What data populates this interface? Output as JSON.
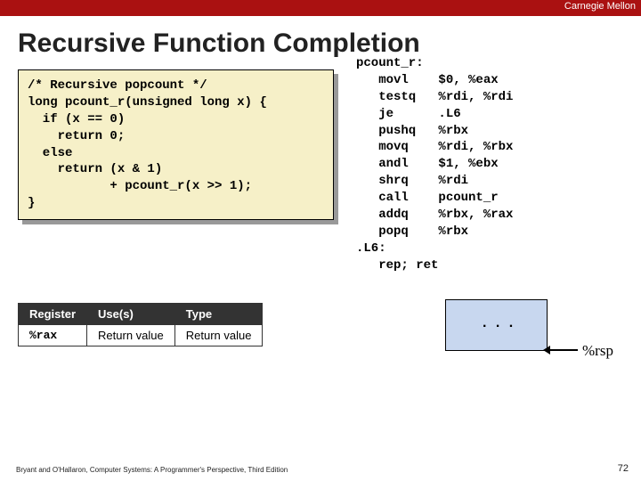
{
  "header": {
    "university": "Carnegie Mellon"
  },
  "title": "Recursive Function Completion",
  "c_code": "/* Recursive popcount */\nlong pcount_r(unsigned long x) {\n  if (x == 0)\n    return 0;\n  else\n    return (x & 1)\n           + pcount_r(x >> 1);\n}",
  "asm": "pcount_r:\n   movl    $0, %eax\n   testq   %rdi, %rdi\n   je      .L6\n   pushq   %rbx\n   movq    %rdi, %rbx\n   andl    $1, %ebx\n   shrq    %rdi\n   call    pcount_r\n   addq    %rbx, %rax\n   popq    %rbx\n.L6:\n   rep; ret",
  "table": {
    "headers": [
      "Register",
      "Use(s)",
      "Type"
    ],
    "row": {
      "reg": "%rax",
      "use": "Return value",
      "type": "Return value"
    }
  },
  "stack": {
    "dots": ". . .",
    "rsp": "%rsp"
  },
  "footer": {
    "credit": "Bryant and O'Hallaron, Computer Systems: A Programmer's Perspective, Third Edition",
    "page": "72"
  }
}
